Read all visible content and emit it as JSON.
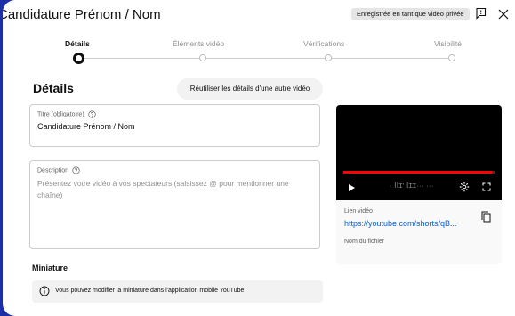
{
  "dialog": {
    "title": "Candidature Prénom / Nom",
    "privacy_badge": "Enregistrée en tant que vidéo privée"
  },
  "stepper": {
    "steps": [
      {
        "label": "Détails",
        "active": true
      },
      {
        "label": "Éléments vidéo",
        "active": false
      },
      {
        "label": "Vérifications",
        "active": false
      },
      {
        "label": "Visibilité",
        "active": false
      }
    ]
  },
  "details": {
    "section_title": "Détails",
    "reuse_button": "Réutiliser les détails d'une autre vidéo",
    "title_field": {
      "label": "Titre (obligatoire)",
      "value": "Candidature Prénom / Nom"
    },
    "description_field": {
      "label": "Description",
      "placeholder": "Présentez votre vidéo à vos spectateurs (saisissez @ pour mentionner une chaîne)"
    },
    "thumbnail": {
      "title": "Miniature",
      "info": "Vous pouvez modifier la miniature dans l'application mobile YouTube"
    }
  },
  "video_panel": {
    "progress": 0.98,
    "link_label": "Lien vidéo",
    "link_value": "https://youtube.com/shorts/qB...",
    "filename_label": "Nom du fichier"
  },
  "colors": {
    "background": "#1c2fa6",
    "link": "#065fd4",
    "progress": "#ff0000"
  }
}
